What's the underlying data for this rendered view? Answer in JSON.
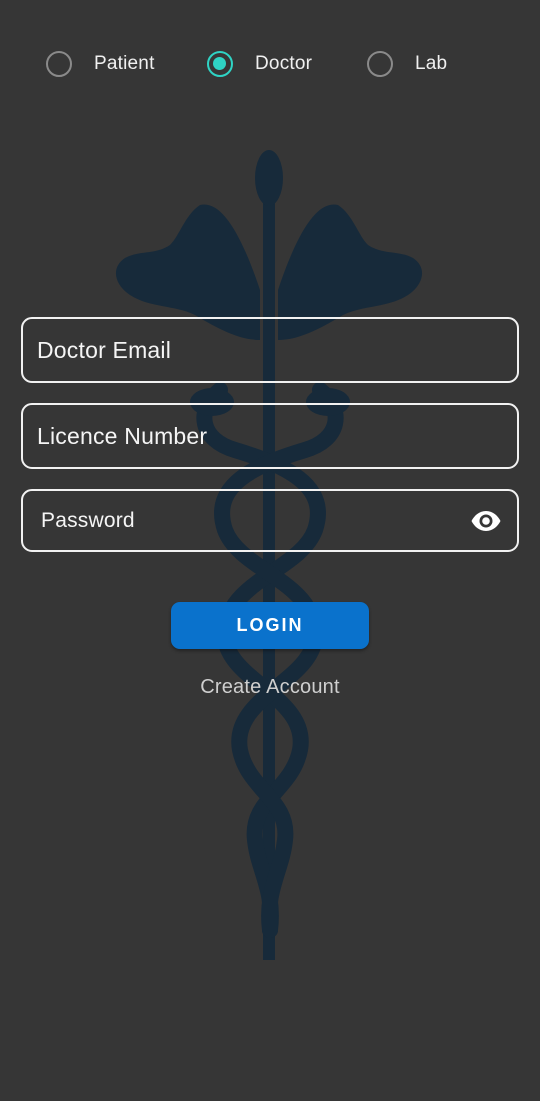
{
  "roles": [
    {
      "label": "Patient",
      "selected": false
    },
    {
      "label": "Doctor",
      "selected": true
    },
    {
      "label": "Lab",
      "selected": false
    }
  ],
  "form": {
    "email_placeholder": "Doctor Email",
    "licence_placeholder": "Licence Number",
    "password_placeholder": "Password"
  },
  "actions": {
    "login_label": "LOGIN",
    "create_account_label": "Create Account"
  },
  "icons": {
    "password_toggle": "eye-icon",
    "background": "caduceus-emblem"
  },
  "colors": {
    "background": "#363636",
    "accent_radio": "#2fd3c4",
    "primary_button": "#0a72cc",
    "emblem": "#172a3a"
  }
}
